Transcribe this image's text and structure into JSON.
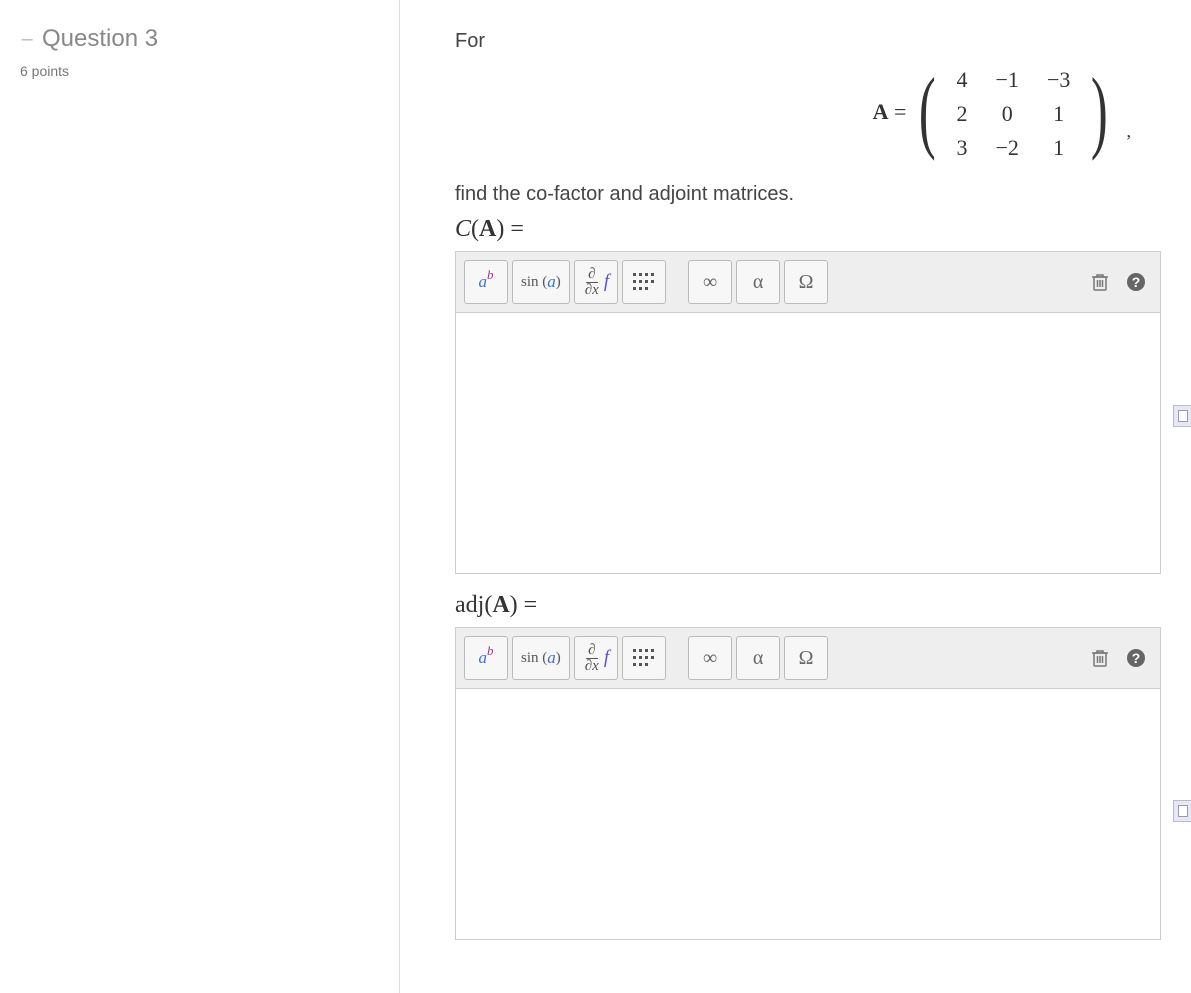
{
  "sidebar": {
    "collapse_glyph": "–",
    "title": "Question 3",
    "points": "6 points"
  },
  "problem": {
    "intro": "For",
    "eq_lhs": "A",
    "eq_mid": " = ",
    "trail": ",",
    "instruction": "find the co-factor and adjoint matrices."
  },
  "matrix": {
    "rows": [
      [
        "4",
        "−1",
        "−3"
      ],
      [
        "2",
        "0",
        "1"
      ],
      [
        "3",
        "−2",
        "1"
      ]
    ]
  },
  "labels": {
    "cofactor_C": "C",
    "cofactor_open": "(",
    "cofactor_A": "A",
    "cofactor_close": ") =",
    "adj_fn": "adj",
    "adj_open": "(",
    "adj_A": "A",
    "adj_close": ") ="
  },
  "toolbar": {
    "ab_a": "a",
    "ab_b": "b",
    "sin": "sin (",
    "sin_a": "a",
    "sin_close": ")",
    "partial": "∂",
    "dx": "∂x",
    "f": "f",
    "infinity": "∞",
    "alpha": "α",
    "omega_cap": "Ω"
  }
}
